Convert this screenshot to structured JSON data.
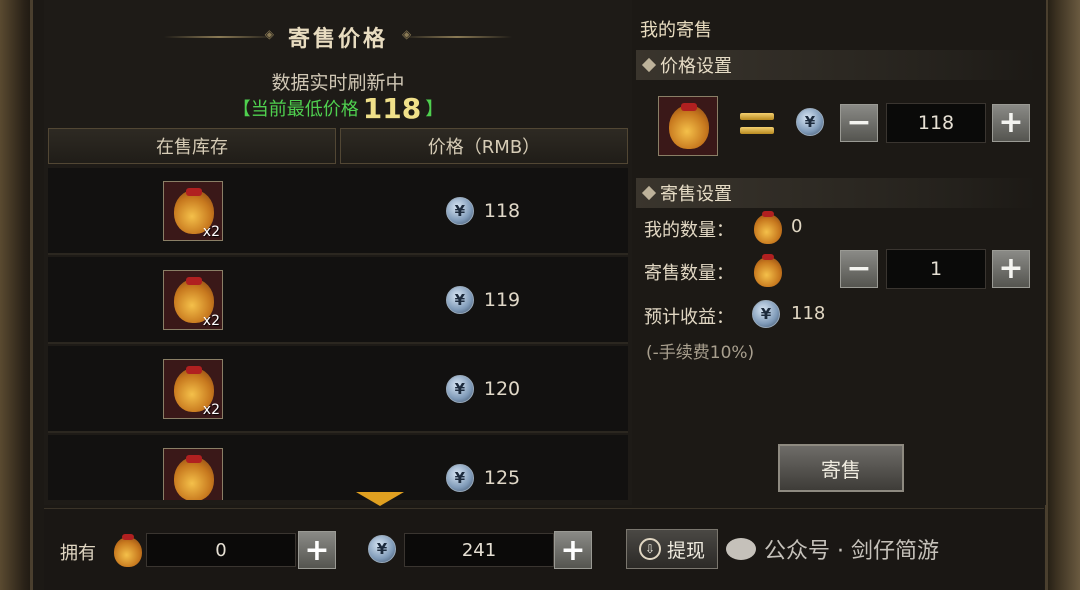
{
  "panel": {
    "title": "寄售价格",
    "refresh_text": "数据实时刷新中",
    "lowest_prefix": "【当前最低价格",
    "lowest_value": "118",
    "lowest_suffix": "】",
    "columns": [
      "在售库存",
      "价格（RMB）"
    ],
    "listings": [
      {
        "count": "x2",
        "price": "118"
      },
      {
        "count": "x2",
        "price": "119"
      },
      {
        "count": "x2",
        "price": "120"
      },
      {
        "count": "",
        "price": "125"
      }
    ]
  },
  "my_sale": {
    "title": "我的寄售",
    "price_section": "价格设置",
    "price_value": "118",
    "sale_section": "寄售设置",
    "my_qty_label": "我的数量：",
    "my_qty_value": "0",
    "sell_qty_label": "寄售数量：",
    "sell_qty_value": "1",
    "income_label": "预计收益：",
    "income_value": "118",
    "fee_note": "(-手续费10%)",
    "sell_button": "寄售"
  },
  "bottom": {
    "own_label": "拥有",
    "own_value": "0",
    "currency_value": "241",
    "withdraw_label": "提现",
    "watermark": "公众号 · 剑仔简游"
  },
  "icons": {
    "plus": "+",
    "minus": "−",
    "yuan": "¥"
  }
}
